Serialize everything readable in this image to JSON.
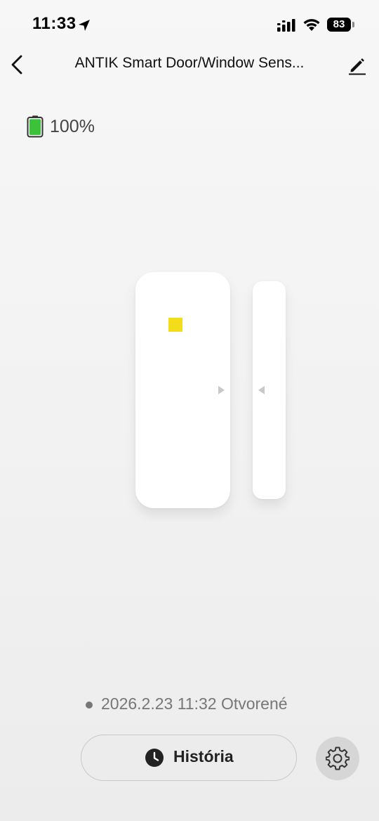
{
  "status_bar": {
    "time": "11:33",
    "battery_percent": "83",
    "icons": [
      "location-arrow-icon",
      "signal-icon",
      "wifi-icon",
      "battery-icon"
    ]
  },
  "header": {
    "title": "ANTIK Smart Door/Window Sens...",
    "back_icon": "chevron-left-icon",
    "edit_icon": "pencil-icon"
  },
  "device": {
    "battery_level": "100%",
    "battery_fraction": 1.0,
    "led_color": "#f3dd1a"
  },
  "last_event": {
    "text": "2026.2.23 11:32 Otvorené"
  },
  "actions": {
    "history_label": "História",
    "history_icon": "clock-icon",
    "settings_icon": "gear-icon"
  }
}
